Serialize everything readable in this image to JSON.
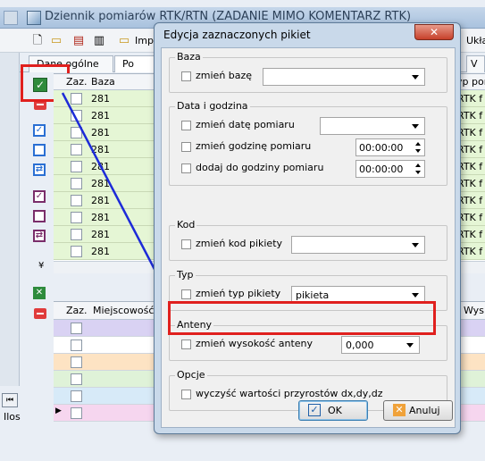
{
  "background_window": {
    "title": "Dziennik pomiarów RTK/RTN (ZADANIE MIMO KOMENTARZ RTK)",
    "toolbar_label": "Impo",
    "toolbar_right_label": "Ukła",
    "tabs": [
      "Dane ogólne",
      "Po",
      "V"
    ],
    "grid_top": {
      "headers": [
        "Zaz.",
        "Baza"
      ],
      "right_header": "yp por",
      "rows": [
        {
          "baza": "281",
          "right": "RTK f"
        },
        {
          "baza": "281",
          "right": "RTK f"
        },
        {
          "baza": "281",
          "right": "RTK f"
        },
        {
          "baza": "281",
          "right": "RTK f"
        },
        {
          "baza": "281",
          "right": "RTK f"
        },
        {
          "baza": "281",
          "right": "RTK f"
        },
        {
          "baza": "281",
          "right": "RTK f"
        },
        {
          "baza": "281",
          "right": "RTK f"
        },
        {
          "baza": "281",
          "right": "RTK f"
        },
        {
          "baza": "281",
          "right": "RTK f"
        }
      ]
    },
    "grid_bottom": {
      "headers": [
        "Zaz.",
        "Miejscowość"
      ],
      "right_header": "Wys",
      "row_colors": [
        "#d9d2f3",
        "#ffffff",
        "#fde3c3",
        "#dff2d8",
        "#d7eaf8",
        "#f6d6ef"
      ]
    },
    "status_label": "Ilos",
    "colors": {
      "row_green": "#e5f6d5",
      "accent_red": "#e0201e",
      "arrow_blue": "#1d2bd8"
    }
  },
  "dialog": {
    "title": "Edycja zaznaczonych pikiet",
    "close_label": "✕",
    "groups": {
      "baza": {
        "title": "Baza",
        "rows": [
          {
            "label": "zmień bazę",
            "value": ""
          }
        ]
      },
      "data": {
        "title": "Data i godzina",
        "rows": [
          {
            "label": "zmień datę pomiaru",
            "value": ""
          },
          {
            "label": "zmień godzinę pomiaru",
            "value": "00:00:00"
          },
          {
            "label": "dodaj do godziny pomiaru",
            "value": "00:00:00"
          }
        ]
      },
      "kod": {
        "title": "Kod",
        "rows": [
          {
            "label": "zmień kod pikiety",
            "value": ""
          }
        ]
      },
      "typ": {
        "title": "Typ",
        "rows": [
          {
            "label": "zmień typ pikiety",
            "value": "pikieta"
          }
        ]
      },
      "anteny": {
        "title": "Anteny",
        "rows": [
          {
            "label": "zmień wysokość anteny",
            "value": "0,000"
          }
        ]
      },
      "opcje": {
        "title": "Opcje",
        "rows": [
          {
            "label": "wyczyść wartości przyrostów dx,dy,dz"
          }
        ]
      }
    },
    "buttons": {
      "ok_label": "OK",
      "cancel_label": "Anuluj"
    }
  }
}
